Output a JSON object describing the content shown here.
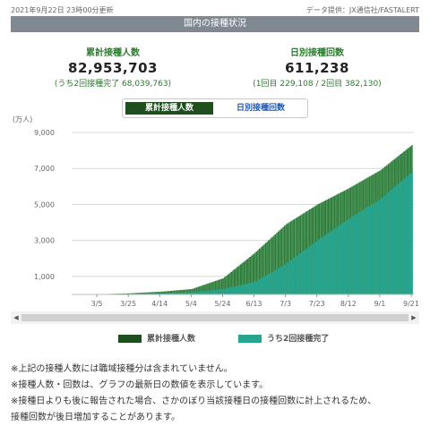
{
  "header": {
    "updated": "2021年9月22日 23時00分更新",
    "source": "データ提供：JX通信社/FASTALERT",
    "title": "国内の接種状況"
  },
  "stats": {
    "cumulative_label": "累計接種人数",
    "cumulative_value": "82,953,703",
    "cumulative_sub": "(うち2回接種完了 68,039,763)",
    "daily_label": "日別接種回数",
    "daily_value": "611,238",
    "daily_sub": "(1回目 229,108 / 2回目 382,130)"
  },
  "tabs": {
    "active": "累計接種人数",
    "inactive": "日別接種回数"
  },
  "legend": {
    "series1": "累計接種人数",
    "series2": "うち2回接種完了"
  },
  "colors": {
    "series1": "#2d7a3a",
    "series2": "#26a48e",
    "header_bg": "#808891"
  },
  "notes": [
    "※上記の接種人数には職域接種分は含まれていません。",
    "※接種人数・回数は、グラフの最新日の数値を表示しています。",
    "※接種日よりも後に報告された場合、さかのぼり当該接種日の接種回数に計上されるため、",
    "接種回数が後日増加することがあります。"
  ],
  "chart_data": {
    "type": "bar",
    "ylabel": "(万人)",
    "ylim": [
      0,
      9000
    ],
    "yticks": [
      "1,000",
      "3,000",
      "5,000",
      "7,000",
      "9,000"
    ],
    "xticks": [
      "3/5",
      "3/25",
      "4/14",
      "5/4",
      "5/24",
      "6/13",
      "7/3",
      "7/23",
      "8/12",
      "9/1",
      "9/21"
    ],
    "series": [
      {
        "name": "累計接種人数",
        "x": [
          "2/17",
          "3/5",
          "3/25",
          "4/14",
          "5/4",
          "5/24",
          "6/13",
          "7/3",
          "7/23",
          "8/12",
          "9/1",
          "9/21"
        ],
        "values": [
          0,
          10,
          60,
          150,
          300,
          900,
          2300,
          3900,
          5000,
          5900,
          6900,
          8295
        ]
      },
      {
        "name": "うち2回接種完了",
        "x": [
          "2/17",
          "3/5",
          "3/25",
          "4/14",
          "5/4",
          "5/24",
          "6/13",
          "7/3",
          "7/23",
          "8/12",
          "9/1",
          "9/21"
        ],
        "values": [
          0,
          0,
          20,
          50,
          120,
          300,
          700,
          1700,
          3000,
          4200,
          5300,
          6804
        ]
      }
    ]
  }
}
